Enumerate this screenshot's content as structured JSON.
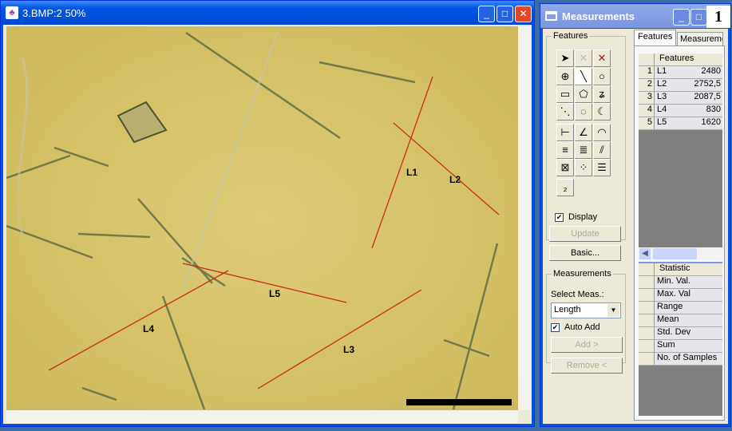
{
  "image_window": {
    "title": "3.BMP:2 50%",
    "labels": [
      "L1",
      "L2",
      "L3",
      "L4",
      "L5"
    ],
    "measure_color": "#cc2a1a"
  },
  "meas_window": {
    "title": "Measurements",
    "badge": "1",
    "features_group": "Features",
    "display_label": "Display",
    "display_checked": true,
    "update_button": "Update",
    "basic_button": "Basic...",
    "measurements_group": "Measurements",
    "select_label": "Select Meas.:",
    "select_value": "Length",
    "auto_add_label": "Auto Add",
    "auto_add_checked": true,
    "add_button": "Add >",
    "remove_button": "Remove <",
    "tabs": [
      "Features",
      "Measureme"
    ],
    "features_header": "Features",
    "features": [
      {
        "n": "1",
        "name": "L1",
        "value": "2480"
      },
      {
        "n": "2",
        "name": "L2",
        "value": "2752,5"
      },
      {
        "n": "3",
        "name": "L3",
        "value": "2087,5"
      },
      {
        "n": "4",
        "name": "L4",
        "value": "830"
      },
      {
        "n": "5",
        "name": "L5",
        "value": "1620"
      }
    ],
    "statistic_header": "Statistic",
    "statistics": [
      "Min. Val.",
      "Max. Val",
      "Range",
      "Mean",
      "Std. Dev",
      "Sum",
      "No. of Samples"
    ],
    "tools": [
      "pointer-icon",
      "delete-disabled-icon",
      "delete-icon",
      "crosshair-icon",
      "line-icon",
      "circle-icon",
      "rectangle-icon",
      "polygon-icon",
      "freehand-icon",
      "dotted-line-icon",
      "dotted-circle-icon",
      "arc-icon",
      "distance-icon",
      "angle-icon",
      "protractor-icon",
      "caliper-icon",
      "multi-line-icon",
      "parallel-icon",
      "grid-icon",
      "particles-icon",
      "list-icon",
      "numbering-icon"
    ],
    "tool_glyphs": [
      "➤",
      "✕",
      "✕",
      "⊕",
      "╲",
      "○",
      "▭",
      "⬠",
      "ʑ",
      "⋱",
      "◌",
      "☾",
      "⊢",
      "∠",
      "◠",
      "≡",
      "≣",
      "⫽",
      "⊠",
      "⁘",
      "☰",
      "₂"
    ]
  }
}
